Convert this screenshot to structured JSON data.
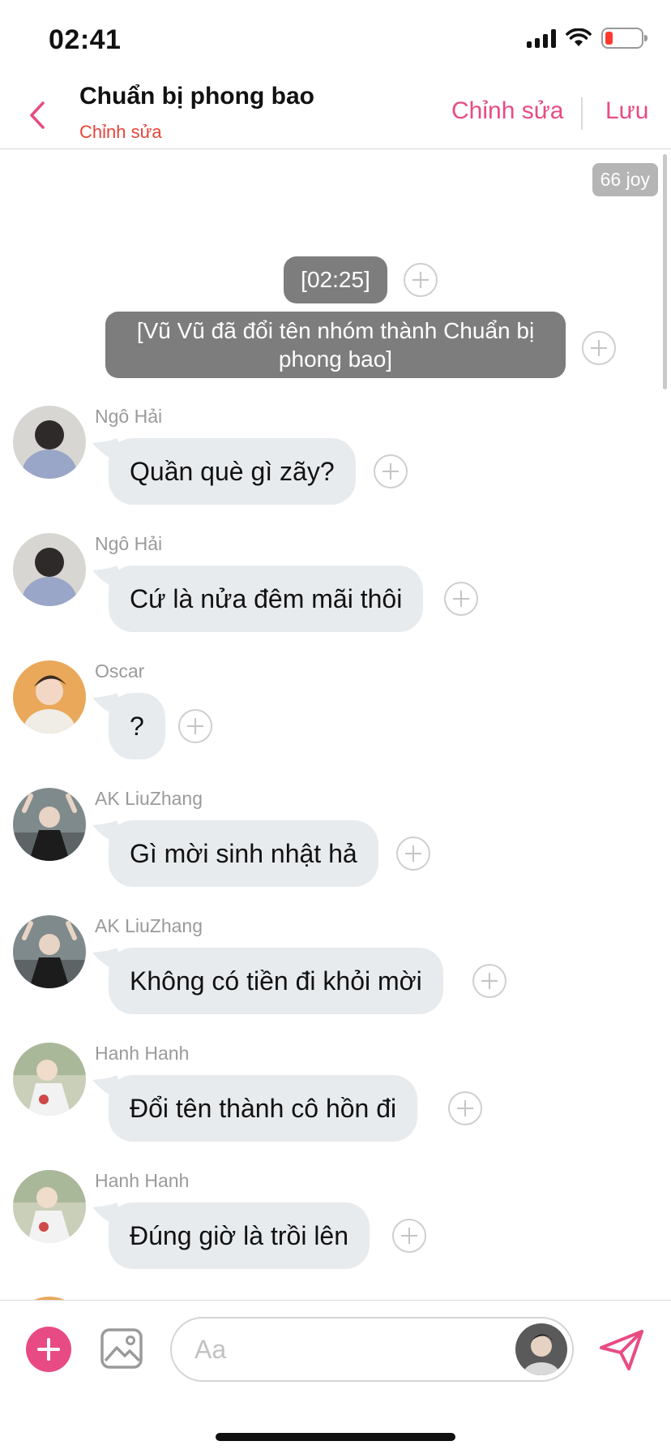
{
  "status": {
    "time": "02:41"
  },
  "header": {
    "title": "Chuẩn bị phong bao",
    "subtitle": "Chỉnh sửa",
    "edit_label": "Chỉnh sửa",
    "save_label": "Lưu"
  },
  "chat": {
    "joy_badge": "66 joy",
    "time_stamp": "[02:25]",
    "system_message": "[Vũ Vũ đã đổi tên nhóm thành Chuẩn bị phong bao]",
    "messages": [
      {
        "sender": "Ngô Hải",
        "text": "Quần què gì zãy?"
      },
      {
        "sender": "Ngô Hải",
        "text": "Cứ là nửa đêm mãi thôi"
      },
      {
        "sender": "Oscar",
        "text": "?"
      },
      {
        "sender": "AK LiuZhang",
        "text": "Gì mời sinh nhật hả"
      },
      {
        "sender": "AK LiuZhang",
        "text": "Không có tiền đi khỏi mời"
      },
      {
        "sender": "Hanh Hanh",
        "text": "Đổi tên thành cô hồn đi"
      },
      {
        "sender": "Hanh Hanh",
        "text": "Đúng giờ là trồi lên"
      }
    ]
  },
  "composer": {
    "placeholder": "Aa"
  },
  "icons": {
    "back": "chevron-left-icon",
    "add": "plus-circle-icon",
    "image": "image-icon",
    "send": "send-icon",
    "react": "plus-icon"
  },
  "colors": {
    "accent": "#e84b83",
    "subtitle_red": "#e8443a",
    "bubble": "#e8ebee",
    "system_bubble": "#7d7d7d"
  }
}
